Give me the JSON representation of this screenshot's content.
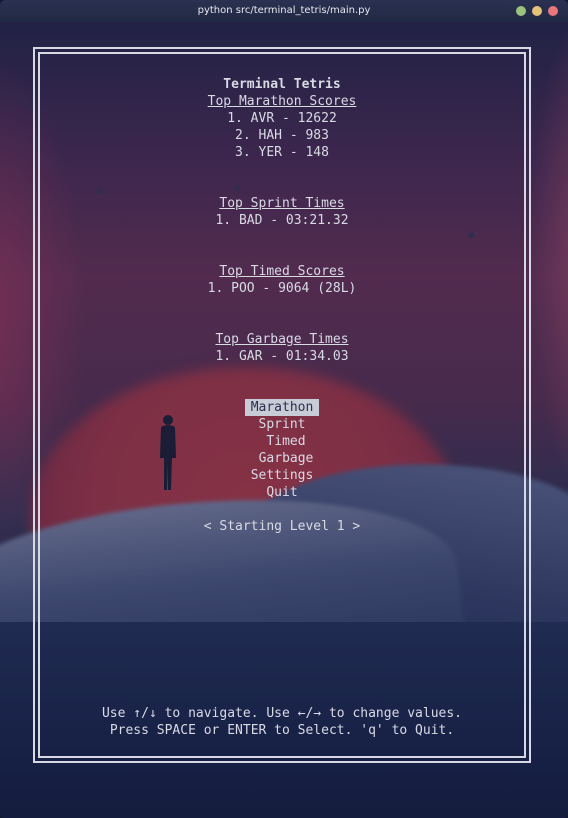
{
  "window": {
    "title": "python src/terminal_tetris/main.py",
    "buttons": [
      {
        "name": "minimize",
        "color": "#9ac27f"
      },
      {
        "name": "maximize",
        "color": "#e5c27a"
      },
      {
        "name": "close",
        "color": "#e9767a"
      }
    ]
  },
  "app": {
    "title": "Terminal Tetris",
    "marathon": {
      "heading": "Top Marathon Scores",
      "entries": [
        "1. AVR - 12622",
        "2. HAH - 983",
        "3. YER - 148"
      ]
    },
    "sprint": {
      "heading": "Top Sprint Times",
      "entries": [
        "1. BAD - 03:21.32"
      ]
    },
    "timed": {
      "heading": "Top Timed Scores",
      "entries": [
        "1. POO - 9064 (28L)"
      ]
    },
    "garbage": {
      "heading": "Top Garbage Times",
      "entries": [
        "1. GAR - 01:34.03"
      ]
    },
    "menu": {
      "selected": "Marathon",
      "items": [
        "Marathon",
        "Sprint",
        "Timed",
        "Garbage",
        "Settings",
        "Quit"
      ]
    },
    "level_selector": "< Starting Level 1 >",
    "help": [
      "Use ↑/↓ to navigate. Use ←/→ to change values.",
      "Press SPACE or ENTER to Select. 'q' to Quit."
    ]
  }
}
